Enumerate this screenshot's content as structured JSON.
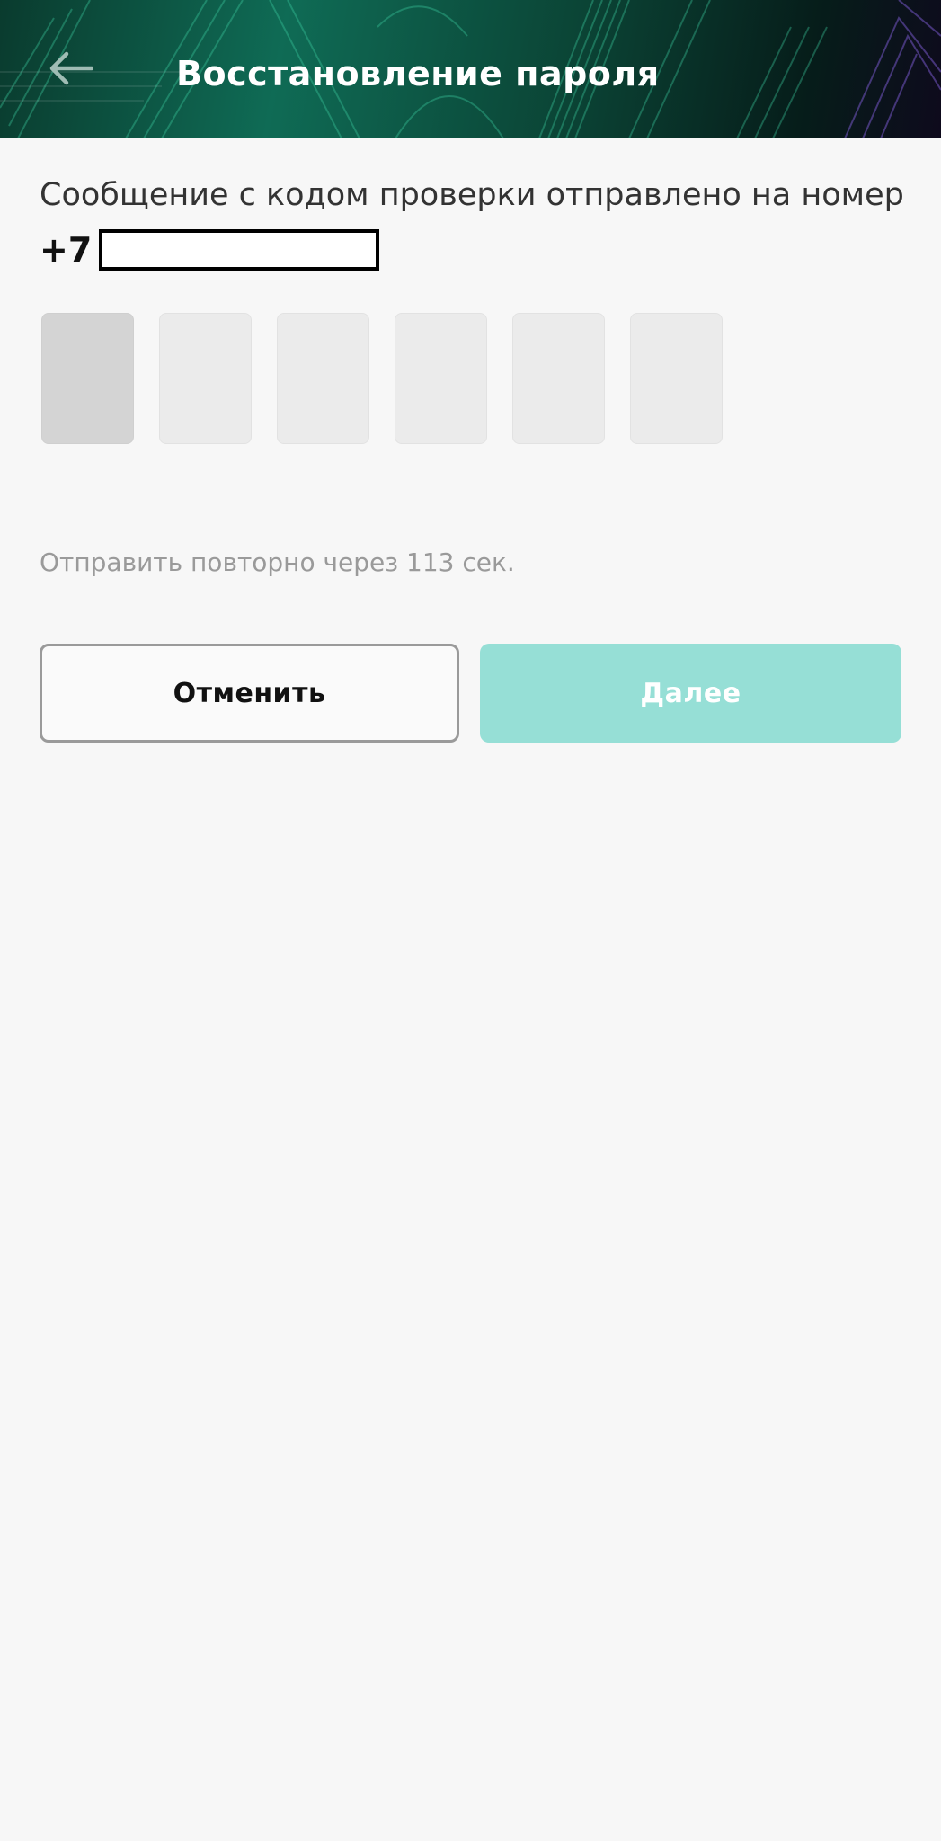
{
  "header": {
    "title": "Восстановление пароля",
    "back_icon": "arrow-left-icon"
  },
  "verification": {
    "message": "Сообщение с кодом проверки отправлено на номер",
    "phone_prefix": "+7",
    "code_length": 6,
    "resend_text": "Отправить повторно через 113 сек."
  },
  "actions": {
    "cancel_label": "Отменить",
    "next_label": "Далее"
  },
  "colors": {
    "header_green": "#0f6b55",
    "next_button_disabled": "#96dfd6",
    "code_cell": "#ebebeb",
    "code_cell_active": "#d4d4d4"
  }
}
